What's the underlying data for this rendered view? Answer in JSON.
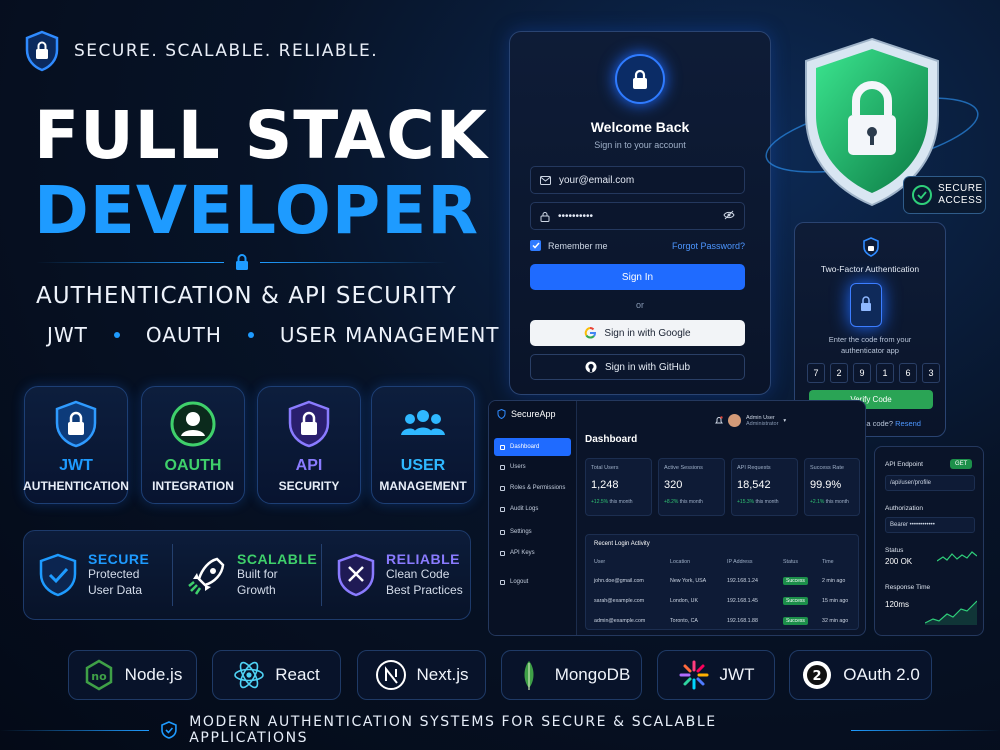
{
  "tagline": "SECURE. SCALABLE. RELIABLE.",
  "title_line1": "FULL STACK",
  "title_line2": "DEVELOPER",
  "subtitle": "AUTHENTICATION & API SECURITY",
  "keywords": [
    "JWT",
    "OAUTH",
    "USER MANAGEMENT"
  ],
  "features": [
    {
      "title": "JWT",
      "subtitle": "AUTHENTICATION",
      "color": "#1e9bff"
    },
    {
      "title": "OAUTH",
      "subtitle": "INTEGRATION",
      "color": "#3fd06b"
    },
    {
      "title": "API",
      "subtitle": "SECURITY",
      "color": "#7b6bff"
    },
    {
      "title": "USER",
      "subtitle": "MANAGEMENT",
      "color": "#2fb8ff"
    }
  ],
  "benefits": [
    {
      "title": "SECURE",
      "line1": "Protected",
      "line2": "User Data",
      "color": "#1e9bff"
    },
    {
      "title": "SCALABLE",
      "line1": "Built for",
      "line2": "Growth",
      "color": "#3fd06b"
    },
    {
      "title": "RELIABLE",
      "line1": "Clean Code",
      "line2": "Best Practices",
      "color": "#8a7bff"
    }
  ],
  "tech_stack": [
    "Node.js",
    "React",
    "Next.js",
    "MongoDB",
    "JWT",
    "OAuth 2.0"
  ],
  "footer": "MODERN AUTHENTICATION SYSTEMS FOR SECURE & SCALABLE APPLICATIONS",
  "login": {
    "title": "Welcome Back",
    "subtitle": "Sign in to your account",
    "email_value": "your@email.com",
    "password_value": "••••••••••",
    "remember": "Remember me",
    "forgot": "Forgot Password?",
    "signin": "Sign In",
    "or": "or",
    "google": "Sign in with Google",
    "github": "Sign in with GitHub"
  },
  "secure_access": {
    "line1": "SECURE",
    "line2": "ACCESS"
  },
  "two_factor": {
    "title": "Two-Factor Authentication",
    "instruction_1": "Enter the code from your",
    "instruction_2": "authenticator app",
    "digits": [
      "7",
      "2",
      "9",
      "1",
      "6",
      "3"
    ],
    "verify": "Verify Code",
    "resend_prompt": "Didn't receive a code?",
    "resend": "Resend"
  },
  "dashboard": {
    "app_name": "SecureApp",
    "nav": [
      "Dashboard",
      "Users",
      "Roles & Permissions",
      "Audit Logs",
      "Settings",
      "API Keys",
      "Logout"
    ],
    "heading": "Dashboard",
    "user_name": "Admin User",
    "user_role": "Administrator",
    "stats": [
      {
        "label": "Total Users",
        "value": "1,248",
        "change": "+12.5%",
        "period": "this month"
      },
      {
        "label": "Active Sessions",
        "value": "320",
        "change": "+8.2%",
        "period": "this month"
      },
      {
        "label": "API Requests",
        "value": "18,542",
        "change": "+15.3%",
        "period": "this month"
      },
      {
        "label": "Success Rate",
        "value": "99.9%",
        "change": "+2.1%",
        "period": "this month"
      }
    ],
    "activity_title": "Recent Login Activity",
    "columns": [
      "User",
      "Location",
      "IP Address",
      "Status",
      "Time"
    ],
    "rows": [
      [
        "john.doe@gmail.com",
        "New York, USA",
        "192.168.1.24",
        "Success",
        "2 min ago"
      ],
      [
        "sarah@example.com",
        "London, UK",
        "192.168.1.45",
        "Success",
        "15 min ago"
      ],
      [
        "admin@example.com",
        "Toronto, CA",
        "192.168.1.88",
        "Success",
        "32 min ago"
      ]
    ]
  },
  "api_panel": {
    "endpoint_label": "API Endpoint",
    "method": "GET",
    "endpoint": "/api/user/profile",
    "auth_label": "Authorization",
    "auth_value": "Bearer ••••••••••••",
    "status_label": "Status",
    "status_value": "200 OK",
    "response_label": "Response Time",
    "response_value": "120ms"
  }
}
